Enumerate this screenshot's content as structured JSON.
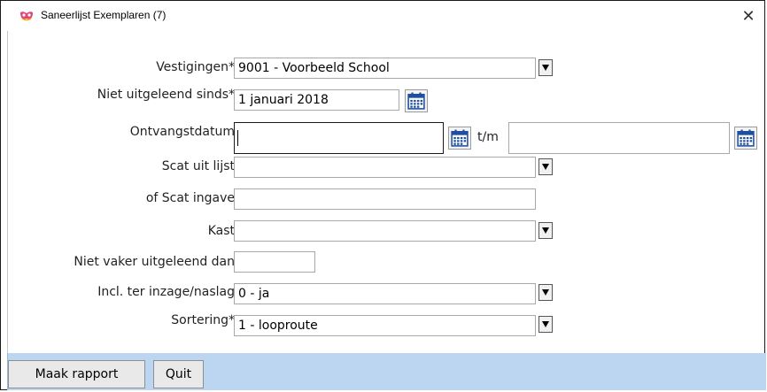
{
  "window": {
    "title": "Saneerlijst Exemplaren (7)",
    "close_glyph": "✕"
  },
  "form": {
    "vestigingen": {
      "label": "Vestigingen*",
      "value": "9001 - Voorbeeld School"
    },
    "niet_uitgeleend_sinds": {
      "label": "Niet uitgeleend sinds*",
      "value": "1 januari 2018"
    },
    "ontvangstdatum": {
      "label": "Ontvangstdatum",
      "from_value": "",
      "separator": "t/m",
      "to_value": ""
    },
    "scat_uit_lijst": {
      "label": "Scat uit lijst",
      "value": ""
    },
    "scat_ingave": {
      "label": "of Scat ingave",
      "value": ""
    },
    "kast": {
      "label": "Kast",
      "value": ""
    },
    "niet_vaker_uitgeleend": {
      "label": "Niet vaker uitgeleend dan",
      "value": ""
    },
    "incl_inzage": {
      "label": "Incl. ter inzage/naslag",
      "value": "0 - ja"
    },
    "sortering": {
      "label": "Sortering*",
      "value": "1 - looproute"
    }
  },
  "footer": {
    "make_report_label": "Maak rapport",
    "quit_label": "Quit"
  },
  "icons": {
    "app": "mask-icon",
    "calendar": "calendar-icon",
    "dropdown": "triangle-down-icon"
  },
  "colors": {
    "footer_bg": "#bcd6f1",
    "calendar_blue": "#1f4fa0"
  }
}
